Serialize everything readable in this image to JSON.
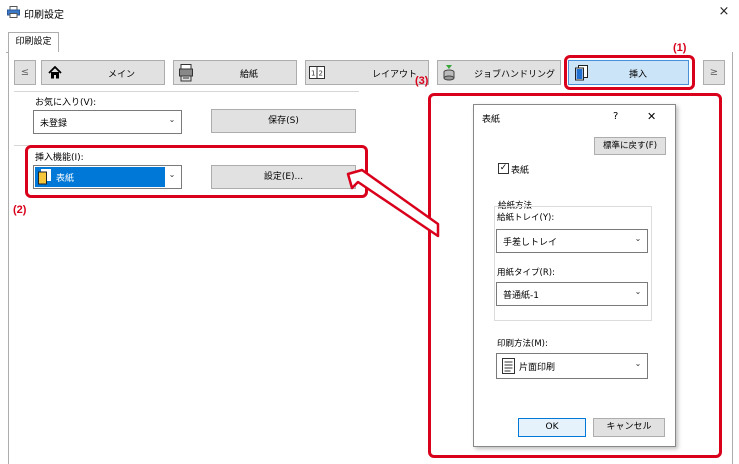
{
  "window": {
    "title": "印刷設定",
    "close_glyph": "×",
    "top_tab": "印刷設定"
  },
  "nav": {
    "prev_glyph": "≤",
    "next_glyph": "≥",
    "tabs": [
      {
        "label": "メイン",
        "icon": "home-icon"
      },
      {
        "label": "給紙",
        "icon": "paper-tray-icon"
      },
      {
        "label": "レイアウト",
        "icon": "layout-icon"
      },
      {
        "label": "ジョブハンドリング",
        "icon": "job-handling-icon"
      },
      {
        "label": "挿入",
        "icon": "insert-icon"
      }
    ]
  },
  "favorites": {
    "label": "お気に入り(V):",
    "value": "未登録",
    "save_button": "保存(S)"
  },
  "insert": {
    "label": "挿入機能(I):",
    "value": "表紙",
    "settings_button": "設定(E)..."
  },
  "callouts": {
    "c1": "(1)",
    "c2": "(2)",
    "c3": "(3)"
  },
  "dialog": {
    "title": "表紙",
    "help_glyph": "?",
    "close_glyph": "✕",
    "reset_button": "標準に戻す(F)",
    "cover_checkbox": "表紙",
    "cover_checked": true,
    "paper_source_group": "給紙方法",
    "tray_label": "給紙トレイ(Y):",
    "tray_value": "手差しトレイ",
    "paper_type_label": "用紙タイプ(R):",
    "paper_type_value": "普通紙-1",
    "print_method_label": "印刷方法(M):",
    "print_method_value": "片面印刷",
    "ok_button": "OK",
    "cancel_button": "キャンセル"
  },
  "colors": {
    "accent_red": "#d9001b",
    "selection_blue": "#0078d7",
    "active_tab_blue": "#cce4f7"
  }
}
